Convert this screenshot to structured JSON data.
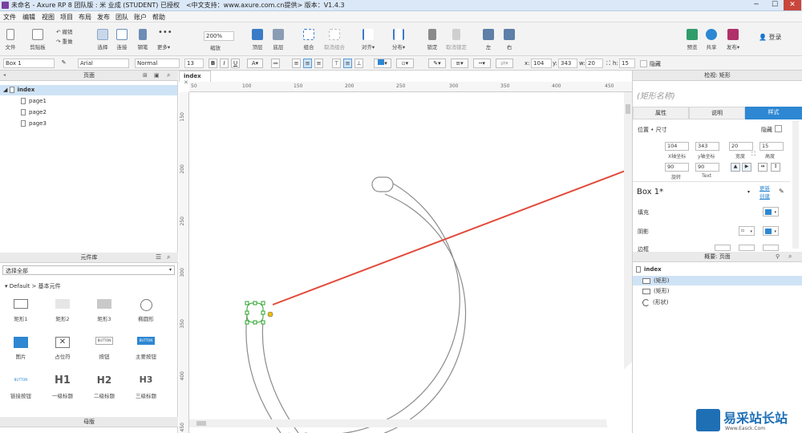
{
  "title_bar": {
    "text": "未命名 - Axure RP 8 团队版 : 米 业成 (STUDENT) 已授权　<中文支持：www.axure.com.cn提供> 版本：V1.4.3",
    "minimize": "─",
    "maximize": "☐",
    "close": "✕"
  },
  "menu": [
    "文件",
    "编辑",
    "视图",
    "项目",
    "布局",
    "发布",
    "团队",
    "账户",
    "帮助"
  ],
  "toolbar": {
    "file": "文件",
    "clipboard": "剪贴板",
    "undo": "撤销",
    "redo": "重做",
    "select": "选择",
    "connect": "连接",
    "pen": "钢笔",
    "more": "更多▾",
    "zoom_value": "200%",
    "zoom": "缩放",
    "top": "顶层",
    "bottom": "底层",
    "group": "组合",
    "ungroup": "取消组合",
    "align": "对齐▾",
    "distribute": "分布▾",
    "lock": "锁定",
    "unlock": "取消锁定",
    "left": "左",
    "right": "右",
    "preview": "预览",
    "share": "共享",
    "publish": "发布▾",
    "login": "登录"
  },
  "format_bar": {
    "shape_name": "Box 1",
    "font": "Arial",
    "style": "Normal",
    "size": "13",
    "bold": "B",
    "italic": "I",
    "underline": "U",
    "x_label": "x:",
    "x": "104",
    "y_label": "y:",
    "y": "343",
    "w_label": "w:",
    "w": "20",
    "h_label": "h:",
    "h": "15",
    "hidden": "隐藏"
  },
  "pages_panel": {
    "title": "页面",
    "root": "index",
    "pages": [
      "page1",
      "page2",
      "page3"
    ]
  },
  "library_panel": {
    "title": "元件库",
    "select_all": "选择全部",
    "group": "Default > 基本元件",
    "widgets": [
      "矩形1",
      "矩形2",
      "矩形3",
      "椭圆形",
      "图片",
      "占位符",
      "按钮",
      "主要按钮",
      "链接按钮",
      "一级标题",
      "二级标题",
      "三级标题"
    ],
    "widget_text": {
      "button": "BUTTON",
      "primary": "BUTTON",
      "link": "BUTTON",
      "h1": "H1",
      "h2": "H2",
      "h3": "H3"
    }
  },
  "master_panel": {
    "title": "母版"
  },
  "canvas": {
    "tab": "index",
    "ruler_h": [
      "50",
      "100",
      "150",
      "200",
      "250",
      "300",
      "350",
      "400",
      "450"
    ],
    "ruler_v": [
      "150",
      "200",
      "250",
      "300",
      "350",
      "400",
      "450"
    ]
  },
  "inspector": {
    "title": "检视: 矩形",
    "name_placeholder": "(矩形名称)",
    "tabs": [
      "属性",
      "说明",
      "样式"
    ],
    "position_size": "位置 • 尺寸",
    "hidden": "隐藏",
    "x": "104",
    "y": "343",
    "w": "20",
    "h": "15",
    "x_cap": "X轴坐标",
    "y_cap": "y轴坐标",
    "w_cap": "宽度",
    "h_cap": "高度",
    "rotate": "90",
    "text_rotate": "90",
    "rotate_cap": "旋转",
    "text_cap": "Text",
    "style_name": "Box 1*",
    "update": "更新",
    "create": "创建",
    "fill": "填充",
    "shadow": "阴影",
    "border": "边框"
  },
  "outline_panel": {
    "title": "概要: 页面",
    "root": "index",
    "items": [
      "(矩形)",
      "(矩形)",
      "(形状)"
    ]
  },
  "watermark": {
    "text": "易采站长站",
    "sub": "Www.Easck.Com"
  },
  "colors": {
    "accent": "#2d87d2",
    "arrow": "#e24a3b",
    "selection": "#2aa12a"
  }
}
